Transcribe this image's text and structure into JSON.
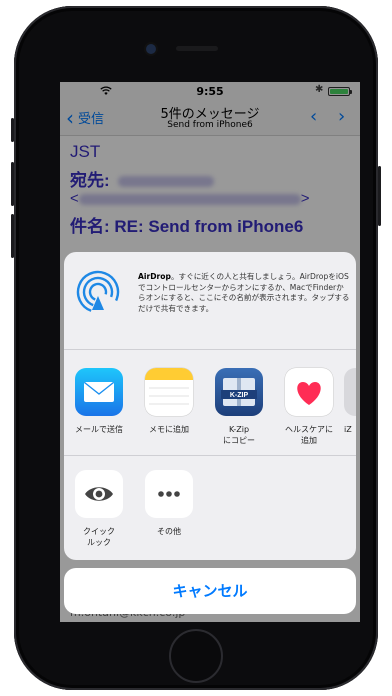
{
  "status_bar": {
    "time": "9:55"
  },
  "nav": {
    "back_label": "受信",
    "title": "5件のメッセージ",
    "subtitle": "Send from iPhone6",
    "up_arrow": "‹",
    "down_arrow": "›"
  },
  "message": {
    "line1": "JST",
    "to_label": "宛先:",
    "bracket_open": "<",
    "bracket_close": ">",
    "subject": "件名: RE: Send from iPhone6",
    "footer": "m.ohtani@kkcn.co.jp"
  },
  "airdrop": {
    "title": "AirDrop",
    "description": "。すぐに近くの人と共有しましょう。AirDropをiOSでコントロールセンターからオンにするか、MacでFinderからオンにすると、ここにその名前が表示されます。タップするだけで共有できます。"
  },
  "share_apps": [
    {
      "icon": "mail-icon",
      "label": "メールで送信"
    },
    {
      "icon": "notes-icon",
      "label": "メモに追加"
    },
    {
      "icon": "kzip-icon",
      "label": "K-Zip\nにコピー",
      "icon_text": "K-ZIP"
    },
    {
      "icon": "health-icon",
      "label": "ヘルスケアに\n追加"
    },
    {
      "icon": "partial-app-icon",
      "label": "iZ"
    }
  ],
  "actions": [
    {
      "icon": "eye-icon",
      "label": "クイック\nルック"
    },
    {
      "icon": "more-icon",
      "label": "その他"
    }
  ],
  "cancel_label": "キャンセル",
  "colors": {
    "accent": "#007aff",
    "message_text": "#3a2fc4",
    "battery": "#4cd964"
  }
}
